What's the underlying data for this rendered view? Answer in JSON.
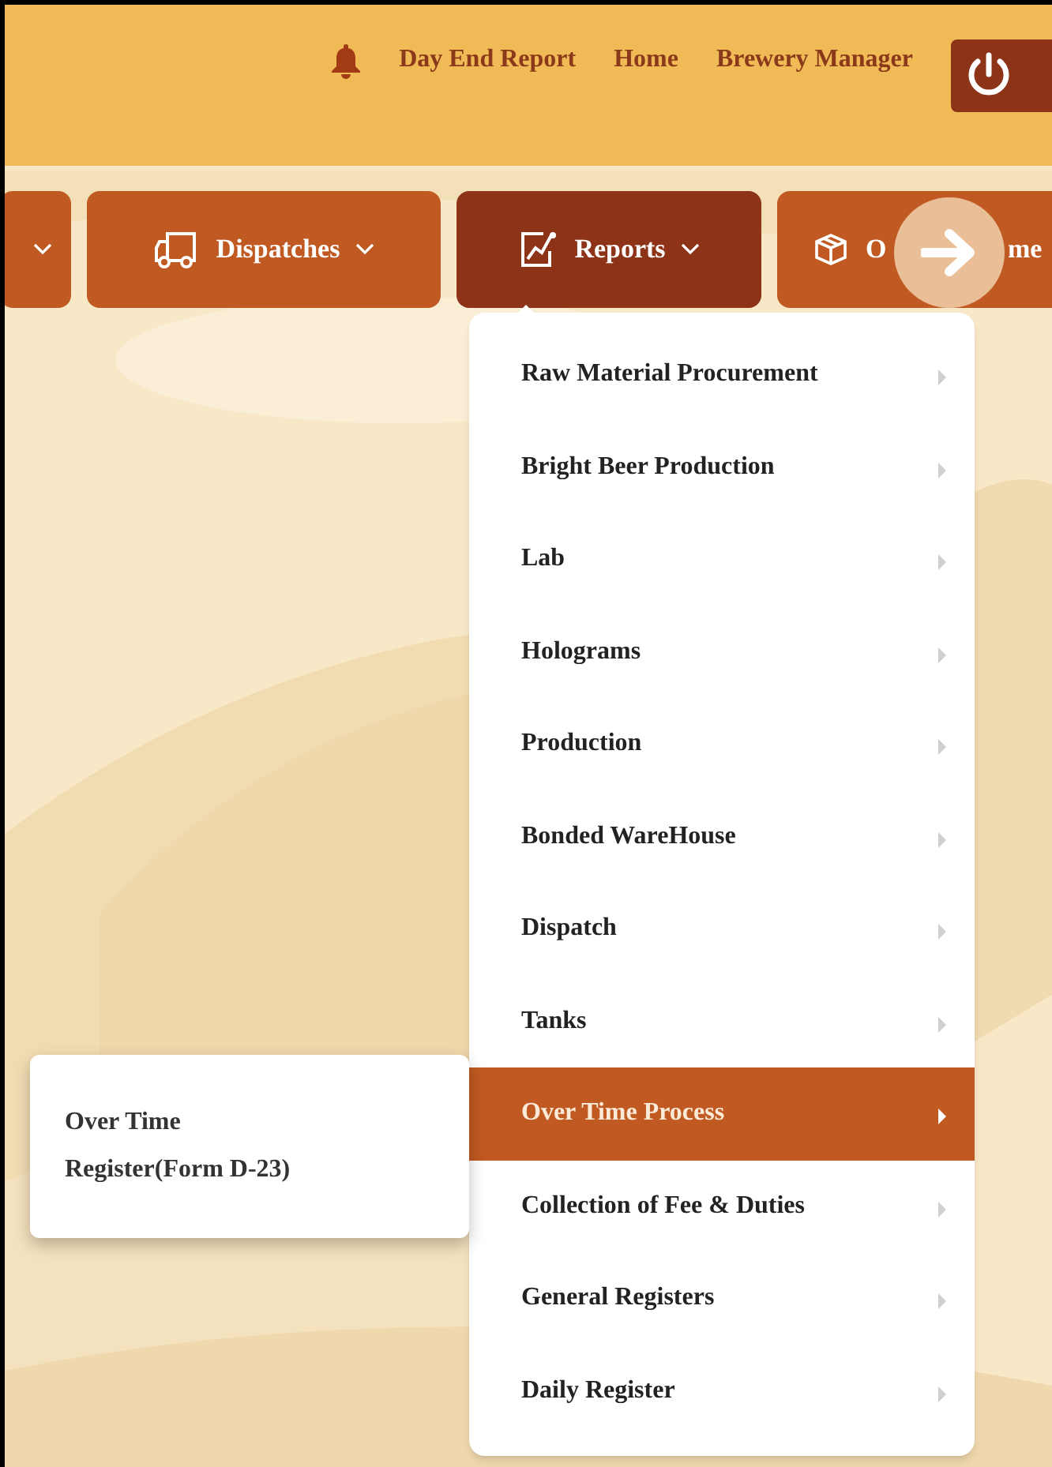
{
  "header": {
    "links": [
      {
        "kind": "bell"
      },
      {
        "kind": "text",
        "label": "Day End Report"
      },
      {
        "kind": "text",
        "label": "Home"
      },
      {
        "kind": "text",
        "label": "Brewery Manager"
      },
      {
        "kind": "power"
      }
    ]
  },
  "nav": {
    "tabs": [
      {
        "selected": false
      },
      {
        "label": "Dispatches",
        "selected": false
      },
      {
        "label": "Reports",
        "selected": true
      },
      {
        "label_start": "O",
        "label_end": "me",
        "selected": false
      }
    ]
  },
  "menu": {
    "items": [
      {
        "label": "Raw Material Procurement",
        "selected": false
      },
      {
        "label": "Bright Beer Production",
        "selected": false
      },
      {
        "label": "Lab",
        "selected": false
      },
      {
        "label": "Holograms",
        "selected": false
      },
      {
        "label": "Production",
        "selected": false
      },
      {
        "label": "Bonded WareHouse",
        "selected": false
      },
      {
        "label": "Dispatch",
        "selected": false
      },
      {
        "label": "Tanks",
        "selected": false
      },
      {
        "label": "Over Time Process",
        "selected": true
      },
      {
        "label": "Collection of Fee & Duties",
        "selected": false
      },
      {
        "label": "General Registers",
        "selected": false
      },
      {
        "label": "Daily Register",
        "selected": false
      }
    ]
  },
  "submenu": {
    "items": [
      {
        "label": "Over Time Register(Form D-23)"
      }
    ]
  }
}
